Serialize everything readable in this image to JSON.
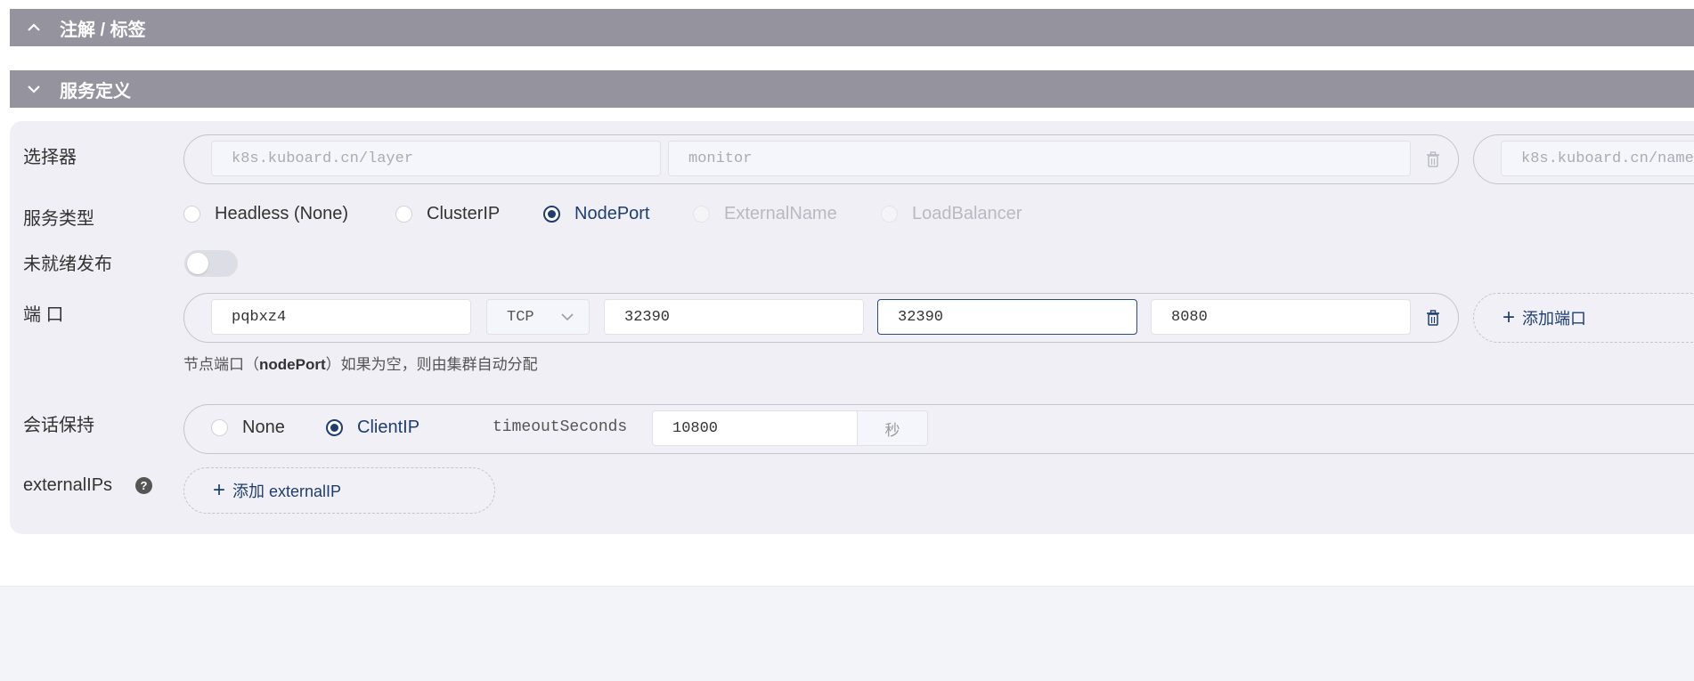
{
  "sections": {
    "annotations_title": "注解 / 标签",
    "service_def_title": "服务定义"
  },
  "selector": {
    "label": "选择器",
    "row1": {
      "key_placeholder": "k8s.kuboard.cn/layer",
      "value_placeholder": "monitor"
    },
    "row2": {
      "key_placeholder": "k8s.kuboard.cn/name"
    }
  },
  "service_type": {
    "label": "服务类型",
    "options": [
      "Headless (None)",
      "ClusterIP",
      "NodePort",
      "ExternalName",
      "LoadBalancer"
    ],
    "selected": "NodePort"
  },
  "unready_publish": {
    "label": "未就绪发布",
    "enabled": false
  },
  "ports": {
    "label": "端 口",
    "name": "pqbxz4",
    "protocol": "TCP",
    "port": "32390",
    "node_port": "32390",
    "target_port": "8080",
    "add_label": "添加端口",
    "hint_prefix": "节点端口（",
    "hint_key": "nodePort",
    "hint_suffix": "）如果为空，则由集群自动分配"
  },
  "session_affinity": {
    "label": "会话保持",
    "options": [
      "None",
      "ClientIP"
    ],
    "selected": "ClientIP",
    "timeout_label": "timeoutSeconds",
    "timeout_value": "10800",
    "unit": "秒"
  },
  "external_ips": {
    "label": "externalIPs",
    "help": "?",
    "add_label": "添加 externalIP"
  },
  "colors": {
    "accent": "#1f3d70",
    "header_bg": "#94939e",
    "panel_bg": "#efeff5"
  }
}
